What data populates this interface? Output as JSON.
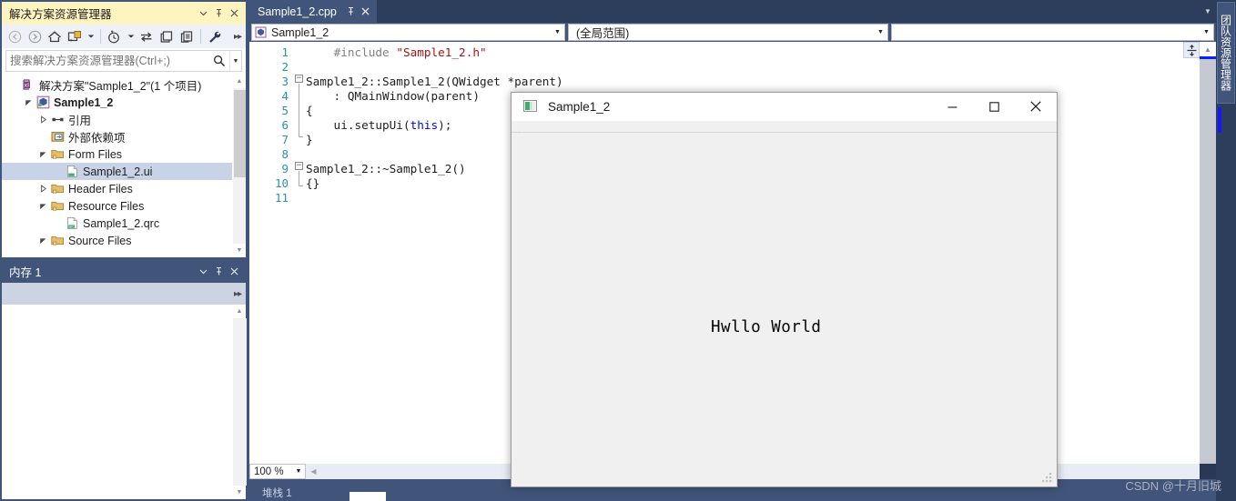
{
  "solution_explorer": {
    "title": "解决方案资源管理器",
    "titlebar_icons": {
      "dropdown": "chevron-down-icon",
      "pin": "pin-icon",
      "close": "close-icon"
    },
    "toolbar": [
      {
        "name": "back-icon",
        "label": "←"
      },
      {
        "name": "forward-icon",
        "label": "→"
      },
      {
        "name": "home-icon",
        "label": "⌂"
      },
      {
        "name": "new-folder-icon",
        "label": "▣"
      },
      {
        "name": "new-folder-dropdown-icon",
        "label": "▾"
      },
      {
        "name": "pending-changes-icon",
        "label": "◷"
      },
      {
        "name": "pending-changes-dropdown-icon",
        "label": "▾"
      },
      {
        "name": "sync-icon",
        "label": "⇆"
      },
      {
        "name": "collapse-all-icon",
        "label": "⿴"
      },
      {
        "name": "show-all-files-icon",
        "label": "⧉"
      },
      {
        "name": "properties-icon",
        "label": "🔧"
      },
      {
        "name": "overflow-icon",
        "label": "▸▸"
      }
    ],
    "search": {
      "placeholder": "搜索解决方案资源管理器(Ctrl+;)",
      "value": "",
      "icon": "search-icon",
      "dropdown_icon": "chevron-down-icon"
    },
    "tree": [
      {
        "label": "解决方案\"Sample1_2\"(1 个项目)",
        "indent": 0,
        "twist": "",
        "icon": "solution-icon",
        "bold": false,
        "selected": false
      },
      {
        "label": "Sample1_2",
        "indent": 1,
        "twist": "▲",
        "icon": "project-icon",
        "bold": true,
        "selected": false
      },
      {
        "label": "引用",
        "indent": 2,
        "twist": "▷",
        "icon": "references-icon",
        "bold": false,
        "selected": false
      },
      {
        "label": "外部依赖项",
        "indent": 2,
        "twist": "",
        "icon": "external-deps-icon",
        "bold": false,
        "selected": false
      },
      {
        "label": "Form Files",
        "indent": 2,
        "twist": "▲",
        "icon": "folder-icon",
        "bold": false,
        "selected": false
      },
      {
        "label": "Sample1_2.ui",
        "indent": 3,
        "twist": "",
        "icon": "ui-file-icon",
        "bold": false,
        "selected": true
      },
      {
        "label": "Header Files",
        "indent": 2,
        "twist": "▷",
        "icon": "folder-icon",
        "bold": false,
        "selected": false
      },
      {
        "label": "Resource Files",
        "indent": 2,
        "twist": "▲",
        "icon": "folder-icon",
        "bold": false,
        "selected": false
      },
      {
        "label": "Sample1_2.qrc",
        "indent": 3,
        "twist": "",
        "icon": "qrc-file-icon",
        "bold": false,
        "selected": false
      },
      {
        "label": "Source Files",
        "indent": 2,
        "twist": "▲",
        "icon": "folder-icon",
        "bold": false,
        "selected": false
      }
    ]
  },
  "memory_panel": {
    "title": "内存 1",
    "titlebar_icons": {
      "dropdown": "chevron-down-icon",
      "pin": "pin-icon",
      "close": "close-icon"
    },
    "toolbar_overflow": "▸▸",
    "content": ""
  },
  "editor": {
    "tab": {
      "name": "Sample1_2.cpp",
      "pin_icon": "pin-icon",
      "close_icon": "close-icon"
    },
    "tabstrip_dropdown_icon": "chevron-down-icon",
    "navbar": {
      "scope_icon": "class-icon",
      "combo1": "Sample1_2",
      "combo2": "(全局范围)",
      "combo3": ""
    },
    "line_numbers": [
      "1",
      "2",
      "3",
      "4",
      "5",
      "6",
      "7",
      "8",
      "9",
      "10",
      "11"
    ],
    "code_lines": [
      {
        "tokens": [
          {
            "t": "    ",
            "c": "plain"
          },
          {
            "t": "#include ",
            "c": "pre"
          },
          {
            "t": "\"Sample1_2.h\"",
            "c": "str"
          }
        ]
      },
      {
        "tokens": []
      },
      {
        "tokens": [
          {
            "t": "Sample1_2::Sample1_2(QWidget *parent)",
            "c": "plain"
          }
        ]
      },
      {
        "tokens": [
          {
            "t": "    : QMainWindow(parent)",
            "c": "plain"
          }
        ]
      },
      {
        "tokens": [
          {
            "t": "{",
            "c": "plain"
          }
        ]
      },
      {
        "tokens": [
          {
            "t": "    ui.setupUi(",
            "c": "plain"
          },
          {
            "t": "this",
            "c": "kw"
          },
          {
            "t": ");",
            "c": "plain"
          }
        ]
      },
      {
        "tokens": [
          {
            "t": "}",
            "c": "plain"
          }
        ]
      },
      {
        "tokens": []
      },
      {
        "tokens": [
          {
            "t": "Sample1_2::~Sample1_2()",
            "c": "plain"
          }
        ]
      },
      {
        "tokens": [
          {
            "t": "{}",
            "c": "plain"
          }
        ]
      },
      {
        "tokens": []
      }
    ],
    "zoom": "100 %",
    "zoom_dropdown_icon": "chevron-down-icon",
    "hscroll_left_icon": "caret-left-icon",
    "split_icon": "split-editor-icon",
    "vscroll_up_icon": "caret-up-icon",
    "status_tab": "堆栈 1"
  },
  "right_dock": {
    "team_explorer_label": "团队资源管理器"
  },
  "qt_window": {
    "title": "Sample1_2",
    "app_icon": "qt-app-icon",
    "controls": {
      "minimize": "−",
      "maximize": "□",
      "close": "✕"
    },
    "label_text": "Hwllo World",
    "resize_grip_icon": "resize-grip-icon"
  },
  "watermark": "CSDN @十月旧城",
  "colors": {
    "vs_dock_blue": "#41547a",
    "active_title_yellow": "#fdf4bf",
    "tree_selection": "#c9d3e8",
    "line_number": "#2b91af",
    "string_red": "#a31515",
    "keyword_blue": "#0000ff",
    "preproc_gray": "#808080",
    "scroll_marker_blue": "#0026ff"
  }
}
